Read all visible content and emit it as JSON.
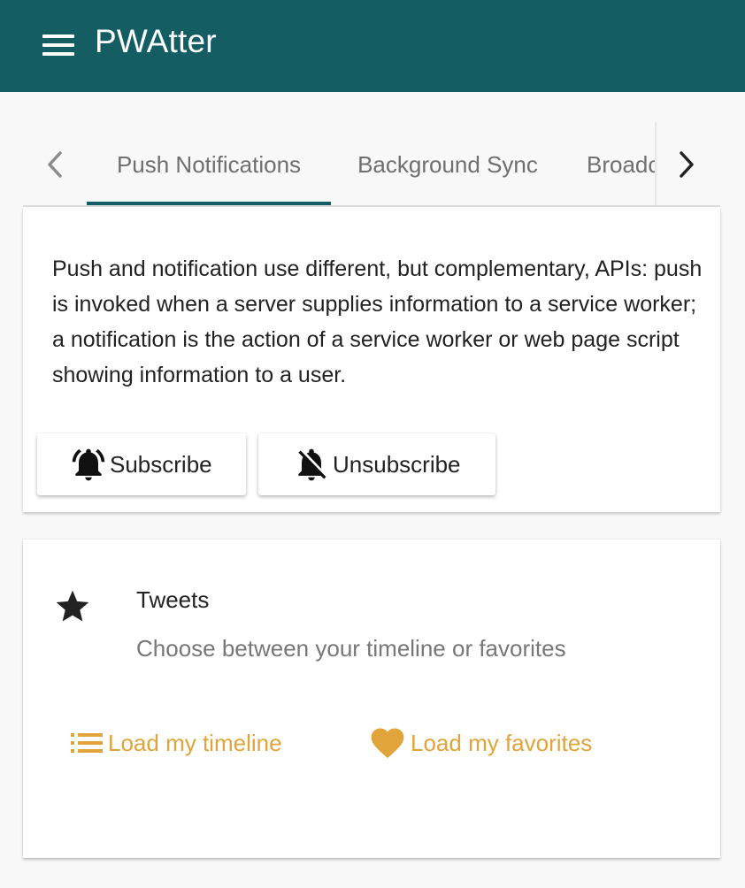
{
  "app_bar": {
    "title": "PWAtter",
    "menu_icon": "menu-icon",
    "background_color": "#135d63"
  },
  "tabs": {
    "items": [
      {
        "label": "Push Notifications",
        "active": true
      },
      {
        "label": "Background Sync",
        "active": false
      },
      {
        "label": "Broadc",
        "active": false
      }
    ],
    "scroll_left_icon": "chevron-left-icon",
    "scroll_right_icon": "chevron-right-icon"
  },
  "push_card": {
    "description": "Push and notification use different, but complementary, APIs: push is invoked when a server supplies information to a service worker; a notification is the action of a service worker or web page script showing information to a user.",
    "subscribe_label": "Subscribe",
    "subscribe_icon": "bell-ringing-icon",
    "unsubscribe_label": "Unsubscribe",
    "unsubscribe_icon": "bell-off-icon"
  },
  "tweets_card": {
    "icon": "star-icon",
    "title": "Tweets",
    "subtitle": "Choose between your timeline or favorites",
    "timeline_label": "Load my timeline",
    "timeline_icon": "list-icon",
    "favorites_label": "Load my favorites",
    "favorites_icon": "heart-icon",
    "accent_color": "#e0a43a"
  }
}
